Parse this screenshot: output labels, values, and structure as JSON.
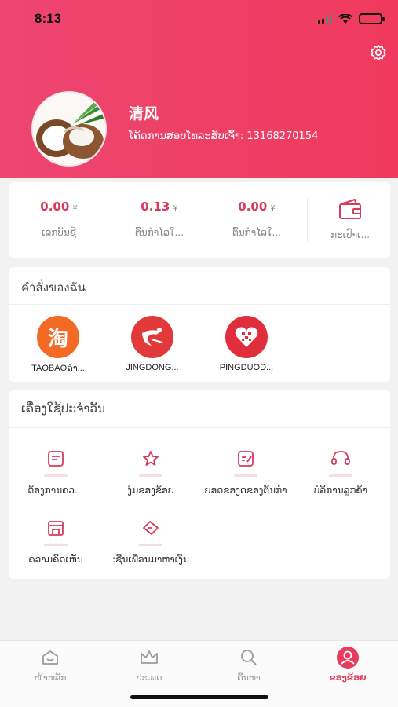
{
  "status": {
    "time": "8:13"
  },
  "profile": {
    "name": "清风",
    "invite_text": "ໂຄ້ດການສອບໂທລະສັບເຈົ້າ: 13168270154"
  },
  "wallet": {
    "currency": "¥",
    "stats": [
      {
        "value": "0.00",
        "label": "ເລກບັນຊີ"
      },
      {
        "value": "0.13",
        "label": "ຕົ້ນກຳໄລໃ..."
      },
      {
        "value": "0.00",
        "label": "ຕົ້ນກຳໄລໃ..."
      }
    ],
    "wallet_label": "ກະເປົາເ..."
  },
  "orders": {
    "title": "คำสั่งของฉัน",
    "items": [
      {
        "label": "TAOBAOຄຳ...",
        "icon": "taobao-icon",
        "color": "#f26a24"
      },
      {
        "label": "JINGDONG...",
        "icon": "jingdong-icon",
        "color": "#e23a3a"
      },
      {
        "label": "PINGDUOD...",
        "icon": "pinduoduo-icon",
        "color": "#e02e3c"
      }
    ]
  },
  "tools": {
    "title": "ເຄື່ອງໃຊ້ປະຈຳວັນ",
    "items": [
      {
        "label": "ຕ້ອງການຄວ...",
        "icon": "document-icon"
      },
      {
        "label": "ງຸ່ມຂອງຂ້ອຍ",
        "icon": "star-icon"
      },
      {
        "label": "ຍອດຂອງດຂອງຕົ້ນກຳ",
        "icon": "edit-icon"
      },
      {
        "label": "ບໍລິການລູກຄ້າ",
        "icon": "headset-icon"
      },
      {
        "label": "ຄວາມຄິດເຫັນ",
        "icon": "store-icon"
      },
      {
        "label": ":ຊືນເພື່ອນມາຫາເງິນ",
        "icon": "coupon-icon"
      }
    ]
  },
  "tabbar": {
    "items": [
      {
        "label": "ໜ້າຫລັກ",
        "icon": "home-icon"
      },
      {
        "label": "ປະເພດ",
        "icon": "crown-icon"
      },
      {
        "label": "ຄົ້ນຫາ",
        "icon": "search-icon"
      },
      {
        "label": "ຂອງຂ້ອຍ",
        "icon": "profile-icon"
      }
    ],
    "active": 3
  },
  "colors": {
    "accent": "#ee3f62",
    "price": "#d93a5c"
  }
}
